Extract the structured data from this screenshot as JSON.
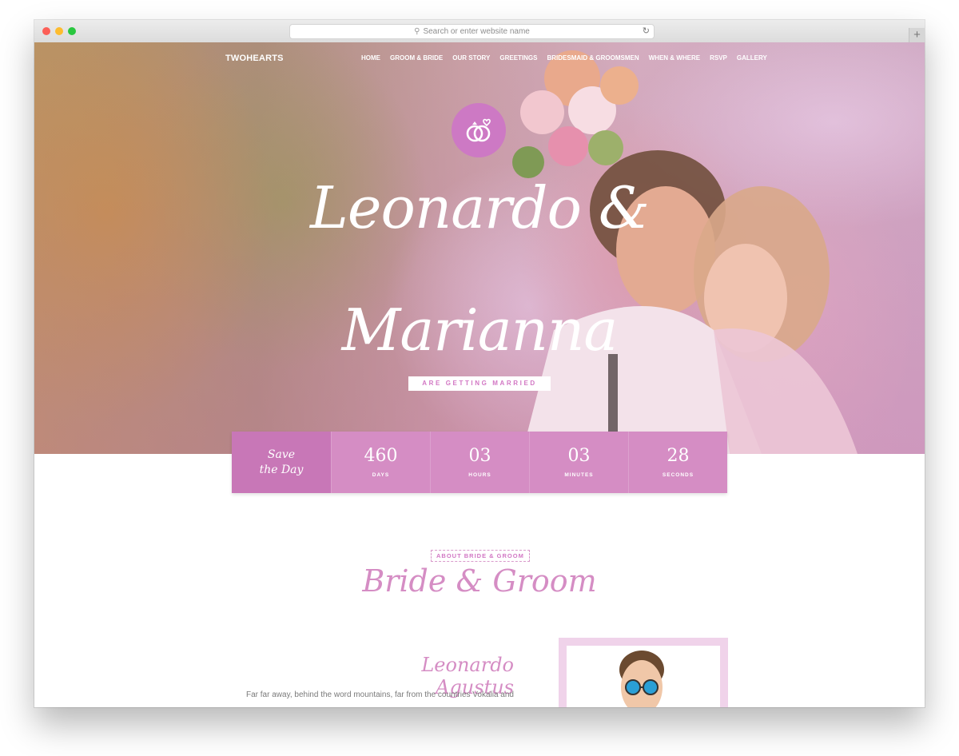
{
  "browser": {
    "url_placeholder": "Search or enter website name",
    "new_tab_label": "+"
  },
  "nav": {
    "logo": "TWOHEARTS",
    "items": [
      "HOME",
      "GROOM & BRIDE",
      "OUR STORY",
      "GREETINGS",
      "BRIDESMAID & GROOMSMEN",
      "WHEN & WHERE",
      "RSVP",
      "GALLERY"
    ]
  },
  "hero": {
    "name_line1": "Leonardo &",
    "name_line2": "Marianna",
    "subtitle": "ARE GETTING MARRIED",
    "badge_icon": "wedding-rings-icon"
  },
  "countdown": {
    "save_line1": "Save",
    "save_line2": "the Day",
    "days": "460",
    "days_label": "DAYS",
    "hours": "03",
    "hours_label": "HOURS",
    "minutes": "03",
    "minutes_label": "MINUTES",
    "seconds": "28",
    "seconds_label": "SECONDS"
  },
  "about": {
    "eyebrow": "ABOUT BRIDE & GROOM",
    "title": "Bride & Groom",
    "groom_name": "Leonardo Agustus",
    "groom_bio": "Far far away, behind the word mountains, far from the countries Vokalia and"
  },
  "colors": {
    "accent": "#d58dc4",
    "accent_dark": "#c877b7",
    "badge": "#cd79c4"
  }
}
